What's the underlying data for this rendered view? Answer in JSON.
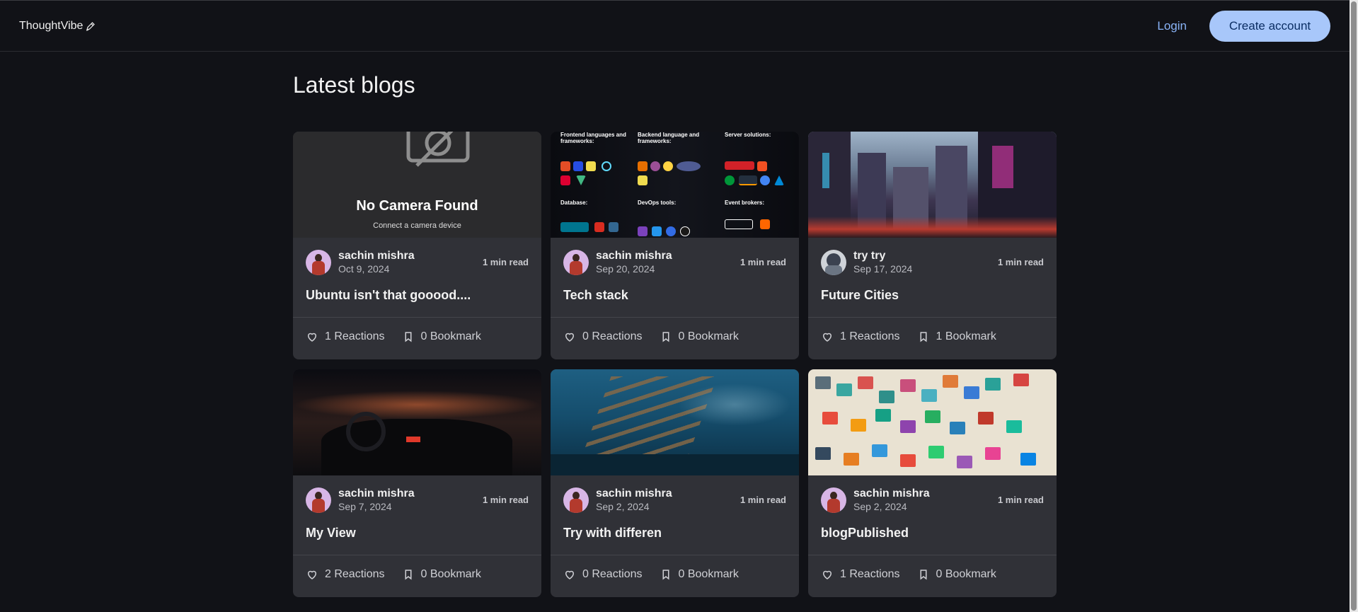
{
  "header": {
    "logo_text": "ThoughtVibe",
    "login_label": "Login",
    "create_account_label": "Create account"
  },
  "page_title": "Latest blogs",
  "thumbnail_text": {
    "no_camera_title": "No Camera Found",
    "no_camera_sub": "Connect a camera device"
  },
  "posts": [
    {
      "author": "sachin mishra",
      "date": "Oct 9, 2024",
      "read_time": "1 min read",
      "title": "Ubuntu isn't that gooood....",
      "reactions": "1 Reactions",
      "bookmarks": "0 Bookmark"
    },
    {
      "author": "sachin mishra",
      "date": "Sep 20, 2024",
      "read_time": "1 min read",
      "title": "Tech stack",
      "reactions": "0 Reactions",
      "bookmarks": "0 Bookmark"
    },
    {
      "author": "try try",
      "date": "Sep 17, 2024",
      "read_time": "1 min read",
      "title": "Future Cities",
      "reactions": "1 Reactions",
      "bookmarks": "1 Bookmark"
    },
    {
      "author": "sachin mishra",
      "date": "Sep 7, 2024",
      "read_time": "1 min read",
      "title": "My View",
      "reactions": "2 Reactions",
      "bookmarks": "0 Bookmark"
    },
    {
      "author": "sachin mishra",
      "date": "Sep 2, 2024",
      "read_time": "1 min read",
      "title": "Try with differen",
      "reactions": "0 Reactions",
      "bookmarks": "0 Bookmark"
    },
    {
      "author": "sachin mishra",
      "date": "Sep 2, 2024",
      "read_time": "1 min read",
      "title": "blogPublished",
      "reactions": "1 Reactions",
      "bookmarks": "0 Bookmark"
    }
  ],
  "tech_stack_image_text": {
    "frontend": "Frontend languages and frameworks:",
    "backend": "Backend language and frameworks:",
    "server": "Server solutions:",
    "database": "Database:",
    "devops": "DevOps tools:",
    "brokers": "Event brokers:"
  },
  "icons": {
    "logo": "pen-icon",
    "reactions": "heart-icon",
    "bookmark": "bookmark-icon",
    "no_camera": "camera-off-icon"
  },
  "colors": {
    "background": "#111217",
    "card": "#303137",
    "accent": "#a8c7fa",
    "link": "#8ab4f8"
  }
}
